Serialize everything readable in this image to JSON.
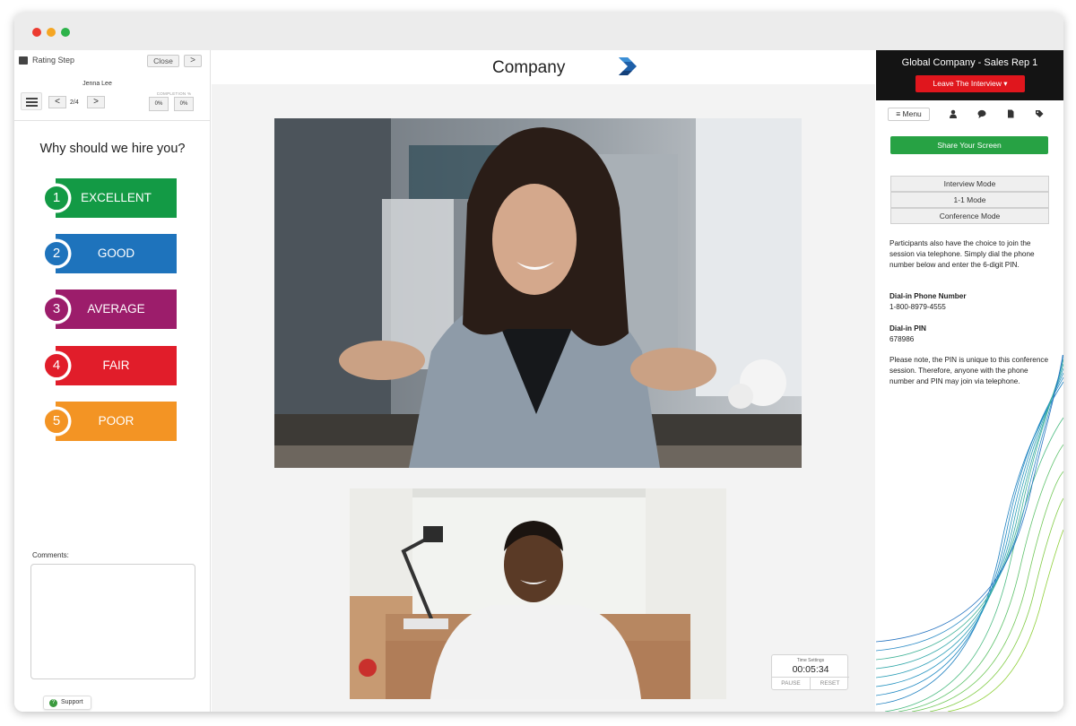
{
  "window": {
    "controls": [
      "close",
      "minimize",
      "zoom"
    ]
  },
  "left_panel": {
    "header_title": "Rating Step",
    "close_label": "Close",
    "next_label": ">",
    "candidate_name": "Jenna Lee",
    "prev_page_label": "<",
    "page_indicator": "2/4",
    "next_page_label": ">",
    "completion_label": "COMPLETION %",
    "completion_a": "0%",
    "completion_b": "0%",
    "question": "Why should we hire  you?",
    "ratings": [
      {
        "number": "1",
        "label": "EXCELLENT",
        "color": "#139a45"
      },
      {
        "number": "2",
        "label": "GOOD",
        "color": "#1e73bc"
      },
      {
        "number": "3",
        "label": "AVERAGE",
        "color": "#9c1d6b"
      },
      {
        "number": "4",
        "label": "FAIR",
        "color": "#e11d2a"
      },
      {
        "number": "5",
        "label": "POOR",
        "color": "#f39424"
      }
    ],
    "comments_label": "Comments:",
    "support_label": "Support"
  },
  "center": {
    "company_name": "Company",
    "timer": {
      "label": "Time Settings",
      "value": "00:05:34",
      "pause": "PAUSE",
      "reset": "RESET"
    }
  },
  "right_panel": {
    "title": "Global Company - Sales Rep 1",
    "leave_label": "Leave The Interview ▾",
    "menu_label": "≡ Menu",
    "icons": [
      "user-icon",
      "chat-icon",
      "document-icon",
      "tag-icon"
    ],
    "share_label": "Share Your Screen",
    "modes": [
      "Interview Mode",
      "1-1 Mode",
      "Conference Mode"
    ],
    "info_text": "Participants also have the choice to join the session via telephone. Simply dial the phone number below and enter the 6-digit PIN.",
    "dial_number_label": "Dial-in Phone Number",
    "dial_number": "1-800-8979-4555",
    "dial_pin_label": "Dial-in PIN",
    "dial_pin": "678986",
    "note": "Please note, the PIN is unique to this conference session.  Therefore, anyone with the phone number and PIN may join via telephone."
  },
  "colors": {
    "leave": "#e0161d",
    "share": "#27a244",
    "header": "#141414"
  }
}
